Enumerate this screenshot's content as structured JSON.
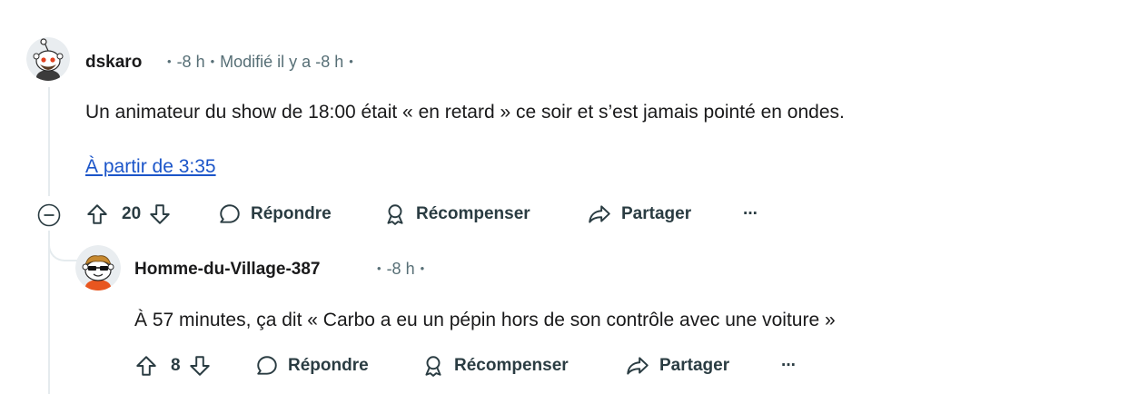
{
  "comments": [
    {
      "username": "dskaro",
      "time": "-8 h",
      "edited": "Modifié il y a -8 h",
      "body": "Un animateur du show de 18:00 était « en retard » ce soir et s’est jamais pointé en ondes.",
      "link": "À partir de 3:35",
      "votes": "20",
      "reply_label": "Répondre",
      "award_label": "Récompenser",
      "share_label": "Partager",
      "more_label": "···"
    },
    {
      "username": "Homme-du-Village-387",
      "time": "-8 h",
      "body": "À 57 minutes, ça dit « Carbo a eu un pépin hors de son contrôle avec une voiture »",
      "votes": "8",
      "reply_label": "Répondre",
      "award_label": "Récompenser",
      "share_label": "Partager",
      "more_label": "···"
    }
  ],
  "colors": {
    "meta": "#576f76",
    "link": "#1b55c9",
    "action": "#2a3c42",
    "thread": "#e5ebee"
  }
}
